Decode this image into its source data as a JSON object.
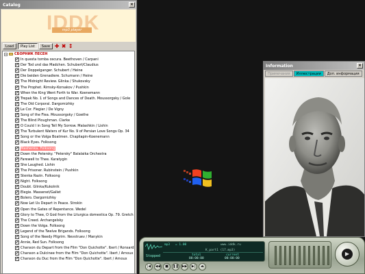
{
  "catalog": {
    "title": "Catalog",
    "close_glyph": "×",
    "logo_text": "IDDK",
    "logo_subtitle": "mp3 player",
    "toolbar": {
      "load_label": "Load",
      "playlist_label": "Play List",
      "save_label": "Save",
      "icons": [
        "add-icon",
        "remove-icon",
        "sort-icon"
      ]
    },
    "root_label": "СБОРНИК ПЕСЕН",
    "tracks": [
      {
        "label": "In questa tomba oscura. Beethoven / Carpani",
        "checked": true
      },
      {
        "label": "Der Tod und das Madchen. Schubert/Claudius",
        "checked": true
      },
      {
        "label": "Der Doppelganger. Schubert / Heine",
        "checked": true
      },
      {
        "label": "Die beiden Grenadiere. Schumann / Heine",
        "checked": true
      },
      {
        "label": "The Midnight Review. Glinka / Shukovsky",
        "checked": true
      },
      {
        "label": "The Prophet. Rimsky-Korsakov / Pushkin",
        "checked": true
      },
      {
        "label": "When the King Went Forth to War. Koenemann",
        "checked": true
      },
      {
        "label": "Trepak No. 1 of Songs and Dances of Death. Moussorgsky / Gole",
        "checked": true
      },
      {
        "label": "The Old Corporal. Dargomizhky",
        "checked": true
      },
      {
        "label": "Le Cor. Flegier / De Vigny",
        "checked": true
      },
      {
        "label": "Song of the Flea. Moussorgsky / Goethe",
        "checked": true
      },
      {
        "label": "The Blind Ploughman. Clarke",
        "checked": true
      },
      {
        "label": "O Could I in Song Tell My Sorrow. Malashkin / Lishin",
        "checked": true
      },
      {
        "label": "The Turbulent Waters of Kur No. 9 of Persian Love Songs Op. 34",
        "checked": true
      },
      {
        "label": "Song or the Volga Boatmen. Chapliapin-Koenemann",
        "checked": true
      },
      {
        "label": "Black Eyes. Folksong",
        "checked": true
      },
      {
        "label": "Mashenka. Folksong",
        "checked": true,
        "selected": true
      },
      {
        "label": "Down the Petersky. \"Petersky\" Balalaika Orchestra",
        "checked": true
      },
      {
        "label": "Farewell to Thee. Karatygin",
        "checked": true
      },
      {
        "label": "She Laughed. Lishin",
        "checked": true
      },
      {
        "label": "The Prisoner. Rubinstein / Pushkin",
        "checked": true
      },
      {
        "label": "Stenka Razin. Folksong",
        "checked": true
      },
      {
        "label": "Night. Folksong",
        "checked": true
      },
      {
        "label": "Doubt. Glinka/Kukolnik",
        "checked": true
      },
      {
        "label": "Elegie. Massenet/Gallet",
        "checked": true
      },
      {
        "label": "Bolero. Dargomizhky",
        "checked": true
      },
      {
        "label": "Now Let Us Depart in Peace. Strokin",
        "checked": true
      },
      {
        "label": "Open the Gates of Repentance. Wedel",
        "checked": true
      },
      {
        "label": "Glory to Thee, O God from the Liturgica domestica Op. 79. Gretch",
        "checked": true
      },
      {
        "label": "The Creed. Archangelsky",
        "checked": true
      },
      {
        "label": "Down the Volga. Folksong",
        "checked": true
      },
      {
        "label": "Legend of the Twelve Brigands. Folksong",
        "checked": true
      },
      {
        "label": "Song of the Needy Pilgrim. Nevstruev / Manykin",
        "checked": true
      },
      {
        "label": "Annie, Red Sun. Folksong",
        "checked": true
      },
      {
        "label": "Chanson du Depart from the Film \"Don Quichotte\". Ibert / Ronsard",
        "checked": true
      },
      {
        "label": "Chanson a Dulcinee from the Film \"Don Quichotte\". Ibert / Arnoux",
        "checked": true
      },
      {
        "label": "Chanson du Duc from the Film \"Don Quichotte\". Ibert / Arnoux",
        "checked": true
      }
    ]
  },
  "info": {
    "title": "Information",
    "tabs": [
      {
        "label": "Примечания",
        "state": "disabled"
      },
      {
        "label": "Иллюстрации",
        "state": "active"
      },
      {
        "label": "Доп. информация",
        "state": "normal"
      }
    ]
  },
  "player": {
    "format": "mp3",
    "volume": "= 1.00",
    "url": "www.iddk.ru",
    "filename": "K_part1 (17.mp3)",
    "status": "Stopped",
    "total_label": "total",
    "current_label": "current",
    "total_time": "00:00:00",
    "current_time": "00:00:00",
    "buttons": [
      {
        "name": "prev-button",
        "glyph": "|◀"
      },
      {
        "name": "rewind-button",
        "glyph": "◀◀"
      },
      {
        "name": "stop-button",
        "glyph": "■"
      },
      {
        "name": "pause-button",
        "glyph": "❚❚"
      },
      {
        "name": "forward-button",
        "glyph": "▶▶"
      },
      {
        "name": "next-button",
        "glyph": "▶|"
      },
      {
        "name": "eject-button",
        "glyph": "⏏"
      }
    ],
    "play_glyph": "▶"
  }
}
